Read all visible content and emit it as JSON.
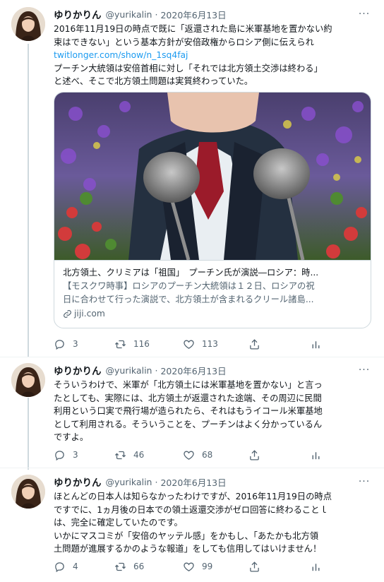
{
  "tweets": [
    {
      "name": "ゆりかりん",
      "handle": "@yurikalin",
      "date": "2020年6月13日",
      "more": "···",
      "lines": [
        "2016年11月19日の時点で既に「返還された島に米軍基地を置かない約",
        "束はできない」という基本方針が安倍政権からロシア側に伝えられ",
        "twitlonger.com/show/n_1sq4faj",
        "プーチン大統領は安倍首相に対し「それでは北方領土交渉は終わる」",
        "と述べ、そこで北方領土問題は実質終わっていた。"
      ],
      "card": {
        "title": "北方領土、クリミアは「祖国」　プーチン氏が演説―ロシア：時...",
        "desc_lines": [
          "【モスクワ時事】ロシアのプーチン大統領は１２日、ロシアの祝",
          "日に合わせて行った演説で、北方領土が含まれるクリール諸島..."
        ],
        "domain": "jiji.com"
      },
      "replies": "3",
      "retweets": "116",
      "likes": "113"
    },
    {
      "name": "ゆりかりん",
      "handle": "@yurikalin",
      "date": "2020年6月13日",
      "more": "···",
      "lines": [
        "そういうわけで、米軍が「北方領土には米軍基地を置かない」と言っ",
        "たとしても、実際には、北方領土が返還された途端、その周辺に民間",
        "利用という口実で飛行場が造られたら、それはもうイコール米軍基地",
        "として利用される。そういうことを、プーチンはよく分かっているん",
        "ですよ。"
      ],
      "replies": "3",
      "retweets": "46",
      "likes": "68"
    },
    {
      "name": "ゆりかりん",
      "handle": "@yurikalin",
      "date": "2020年6月13日",
      "more": "···",
      "lines": [
        "ほとんどの日本人は知らなかったわけですが、2016年11月19日の時点",
        "ですでに、1ヵ月後の日本での領土返還交渉がゼロ回答に終わることｌ",
        "は、完全に確定していたのです。",
        "いかにマスコミが「安倍のヤッテル感」をかもし、「あたかも北方領",
        "土問題が進展するかのような報道」をしても信用してはいけません！"
      ],
      "replies": "4",
      "retweets": "66",
      "likes": "99"
    }
  ],
  "icons": {
    "reply": "reply-icon",
    "retweet": "retweet-icon",
    "like": "heart-icon",
    "share": "share-icon",
    "analytics": "analytics-icon",
    "link": "link-icon"
  },
  "colors": {
    "link": "#1d9bf0",
    "secondary_text": "#536471",
    "border": "#cfd9de"
  }
}
